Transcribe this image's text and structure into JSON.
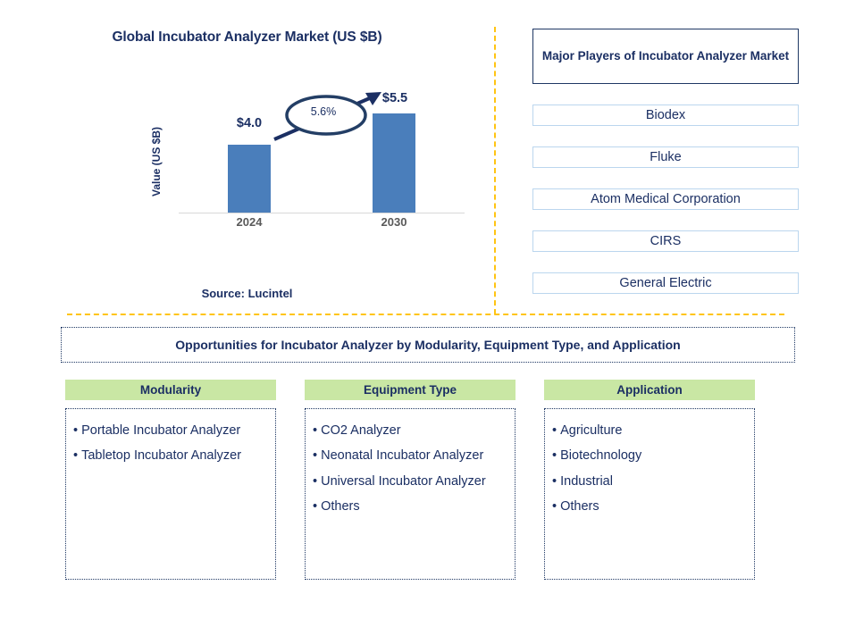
{
  "chart_panel": {
    "title": "Global Incubator Analyzer Market (US $B)",
    "source": "Source: Lucintel"
  },
  "chart_data": {
    "type": "bar",
    "title": "Global Incubator Analyzer Market (US $B)",
    "categories": [
      "2024",
      "2030"
    ],
    "values": [
      4.0,
      5.5
    ],
    "value_labels": [
      "$4.0",
      "$5.5"
    ],
    "xlabel": "",
    "ylabel": "Value (US $B)",
    "ylim": [
      0,
      6.4
    ],
    "grid": false,
    "legend": "none",
    "bar_color": "#4A7EBB",
    "annotation": {
      "label": "5.6%",
      "meaning": "CAGR growth arrow from 2024 bar to 2030 bar"
    }
  },
  "players": {
    "header": "Major Players of Incubator Analyzer Market",
    "items": [
      {
        "name": "Biodex"
      },
      {
        "name": "Fluke"
      },
      {
        "name": "Atom Medical Corporation"
      },
      {
        "name": "CIRS"
      },
      {
        "name": "General Electric"
      }
    ]
  },
  "opportunities": {
    "banner": "Opportunities for Incubator Analyzer by Modularity, Equipment Type, and Application",
    "columns": [
      {
        "header": "Modularity",
        "items": [
          "Portable Incubator Analyzer",
          "Tabletop Incubator Analyzer"
        ]
      },
      {
        "header": "Equipment Type",
        "items": [
          "CO2 Analyzer",
          "Neonatal Incubator Analyzer",
          "Universal Incubator Analyzer",
          "Others"
        ]
      },
      {
        "header": "Application",
        "items": [
          "Agriculture",
          "Biotechnology",
          "Industrial",
          "Others"
        ]
      }
    ]
  },
  "colors": {
    "navy": "#1B2F63",
    "bar_blue": "#4A7EBB",
    "header_green": "#C9E7A4",
    "divider_amber": "#FFC413",
    "player_border": "#BBD6EE"
  }
}
